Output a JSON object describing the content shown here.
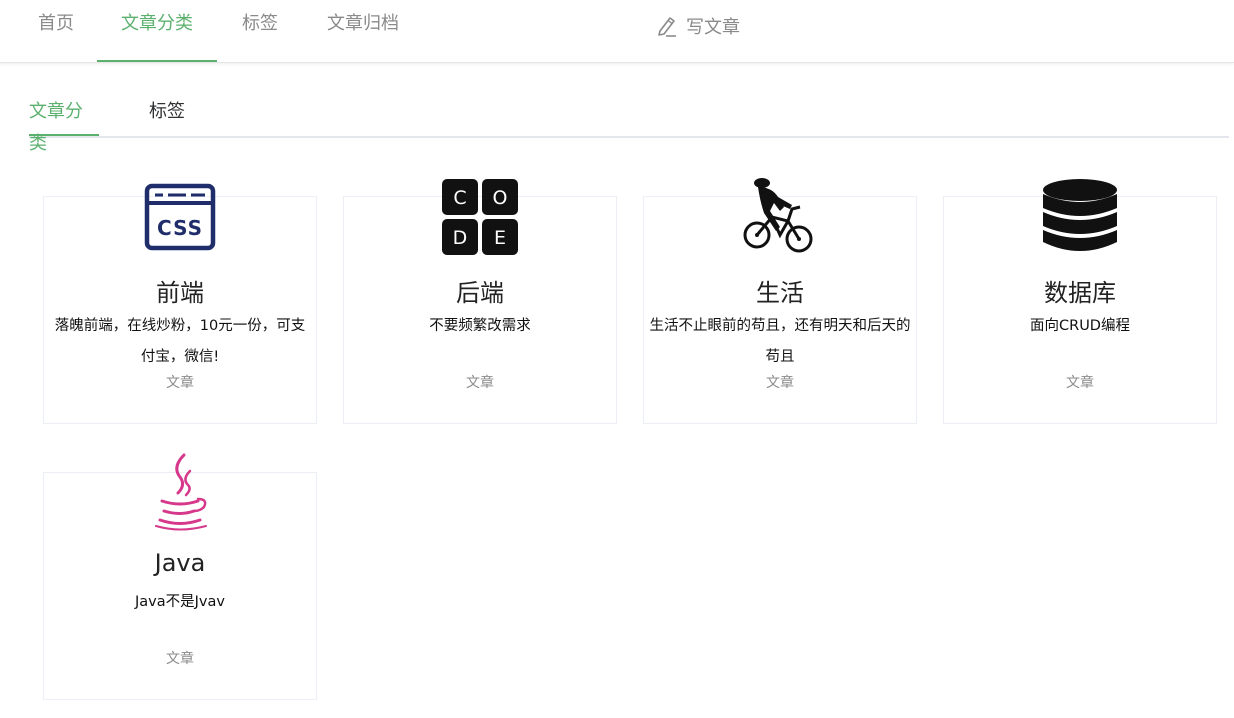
{
  "nav": {
    "items": [
      {
        "label": "首页"
      },
      {
        "label": "文章分类"
      },
      {
        "label": "标签"
      },
      {
        "label": "文章归档"
      }
    ],
    "active_index": 1,
    "write_label": "写文章"
  },
  "subtabs": {
    "items": [
      {
        "label": "文章分类"
      },
      {
        "label": "标签"
      }
    ],
    "active_index": 0
  },
  "categories": [
    {
      "name": "前端",
      "description": "落魄前端，在线炒粉，10元一份，可支付宝，微信!",
      "meta": "文章",
      "icon": "css-icon"
    },
    {
      "name": "后端",
      "description": "不要频繁改需求",
      "meta": "文章",
      "icon": "code-icon"
    },
    {
      "name": "生活",
      "description": "生活不止眼前的苟且，还有明天和后天的苟且",
      "meta": "文章",
      "icon": "cyclist-icon"
    },
    {
      "name": "数据库",
      "description": "面向CRUD编程",
      "meta": "文章",
      "icon": "database-icon"
    },
    {
      "name": "Java",
      "description": "Java不是Jvav",
      "meta": "文章",
      "icon": "java-icon"
    }
  ],
  "colors": {
    "accent": "#5cb06e",
    "muted": "#8a8a8a",
    "css_icon": "#1f2d6b",
    "java_icon": "#d6398b"
  }
}
